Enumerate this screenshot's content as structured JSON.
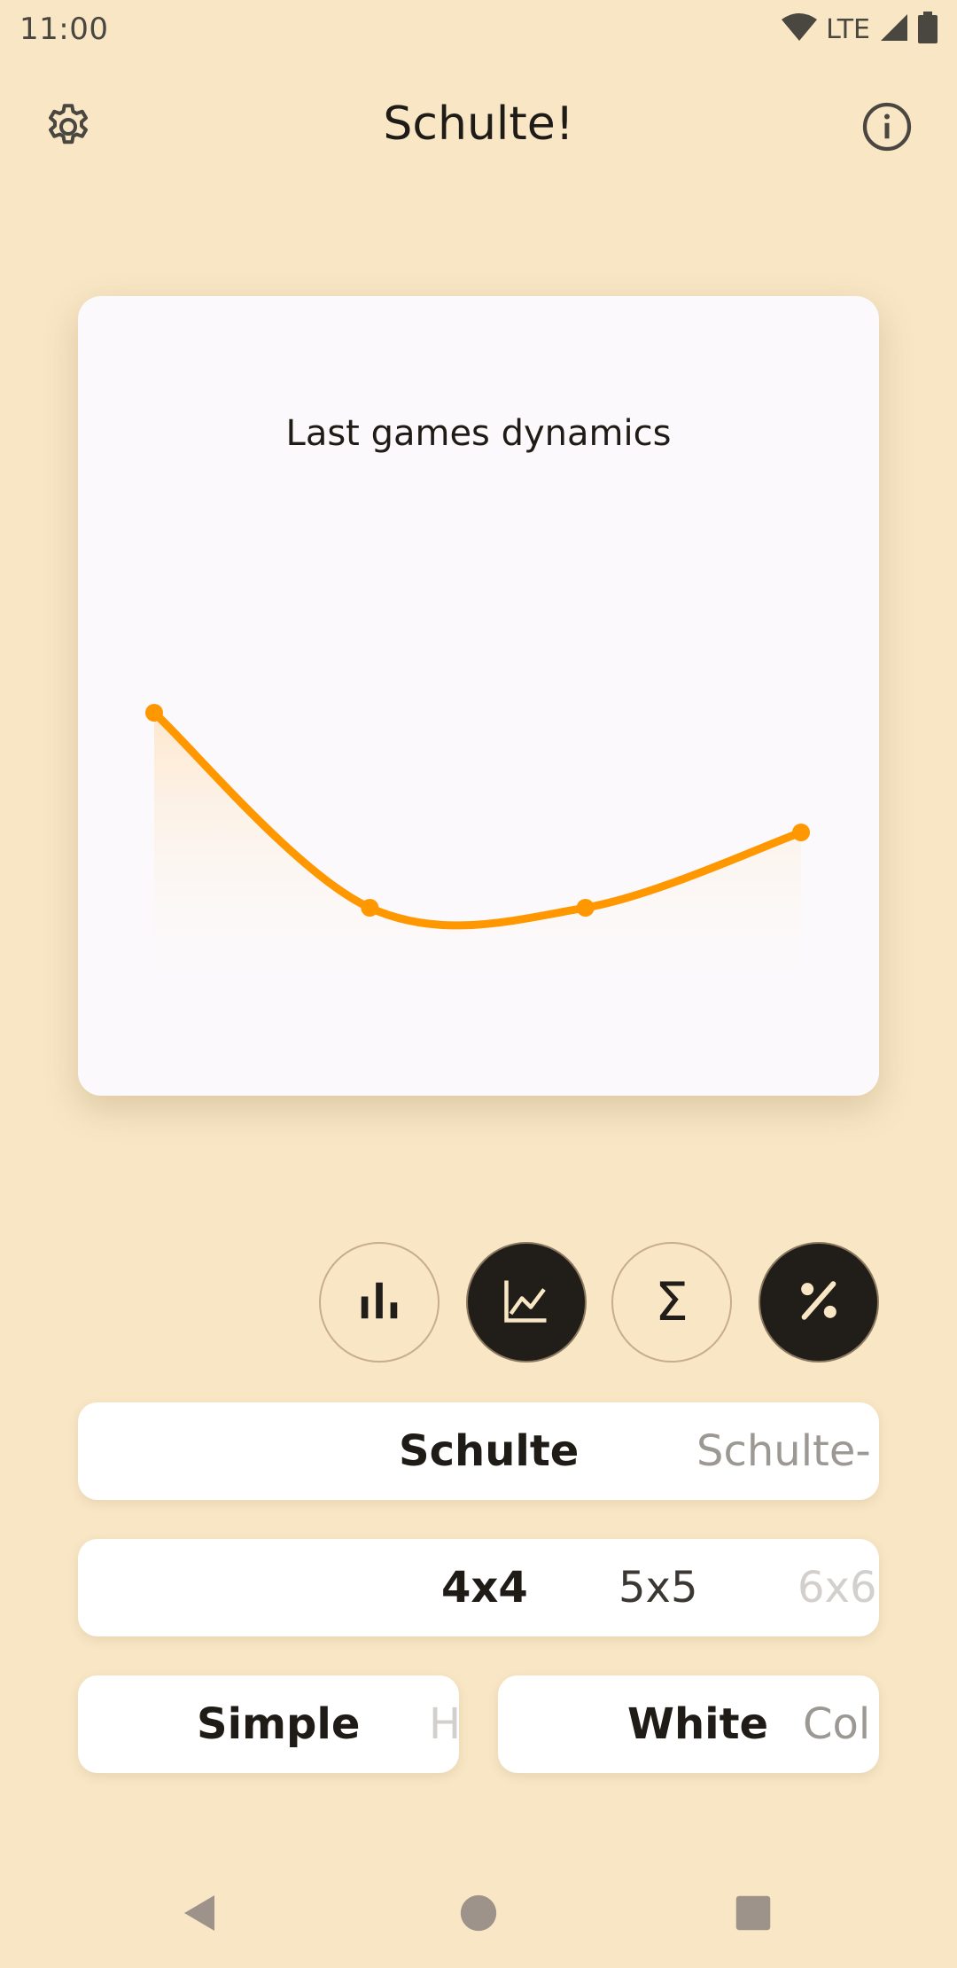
{
  "status_bar": {
    "time": "11:00",
    "network": "LTE",
    "icons": [
      "wifi-icon",
      "cell-signal-icon",
      "battery-icon"
    ]
  },
  "app_bar": {
    "title": "Schulte!",
    "left_icon": "gear-icon",
    "right_icon": "info-icon"
  },
  "chart_data": {
    "type": "area",
    "title": "Last games dynamics",
    "xlabel": "",
    "ylabel": "",
    "x": [
      1,
      2,
      3,
      4
    ],
    "series": [
      {
        "values": [
          0.72,
          0.28,
          0.28,
          0.45
        ]
      }
    ],
    "ylim": [
      0,
      1
    ],
    "grid": false,
    "colors": {
      "line": "#ff9800",
      "fill": "#ffe3bd"
    }
  },
  "round_buttons": [
    {
      "name": "bar-chart-icon",
      "active": false
    },
    {
      "name": "line-chart-icon",
      "active": true
    },
    {
      "name": "sigma-icon",
      "active": false,
      "glyph": "Σ"
    },
    {
      "name": "percent-icon",
      "active": true
    }
  ],
  "pickers": {
    "mode": {
      "selected": "Schulte",
      "next": "Schulte-"
    },
    "size": {
      "selected": "4x4",
      "next": "5x5",
      "after": "6x6"
    },
    "difficulty": {
      "selected": "Simple",
      "next": "H"
    },
    "color": {
      "selected": "White",
      "next": "Col"
    }
  },
  "colors": {
    "background": "#f8e6c5",
    "card": "#fbf9fb",
    "accent": "#ff9800",
    "dark": "#211d18"
  }
}
